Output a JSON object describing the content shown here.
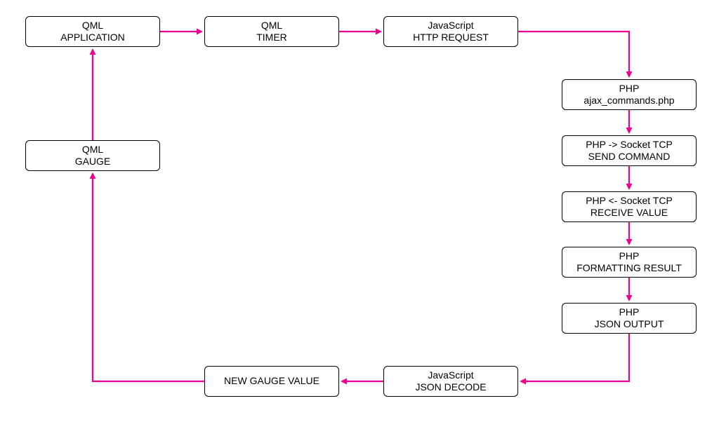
{
  "colors": {
    "arrow": "#ec008c"
  },
  "nodes": {
    "qml_app": {
      "line1": "QML",
      "line2": "APPLICATION"
    },
    "qml_timer": {
      "line1": "QML",
      "line2": "TIMER"
    },
    "js_http": {
      "line1": "JavaScript",
      "line2": "HTTP REQUEST"
    },
    "php_ajax": {
      "line1": "PHP",
      "line2": "ajax_commands.php"
    },
    "php_send": {
      "line1": "PHP -> Socket TCP",
      "line2": "SEND COMMAND"
    },
    "php_recv": {
      "line1": "PHP <- Socket TCP",
      "line2": "RECEIVE VALUE"
    },
    "php_fmt": {
      "line1": "PHP",
      "line2": "FORMATTING RESULT"
    },
    "php_json": {
      "line1": "PHP",
      "line2": "JSON OUTPUT"
    },
    "js_decode": {
      "line1": "JavaScript",
      "line2": "JSON DECODE"
    },
    "new_gauge": {
      "line1": "NEW GAUGE VALUE"
    },
    "qml_gauge": {
      "line1": "QML",
      "line2": "GAUGE"
    }
  }
}
